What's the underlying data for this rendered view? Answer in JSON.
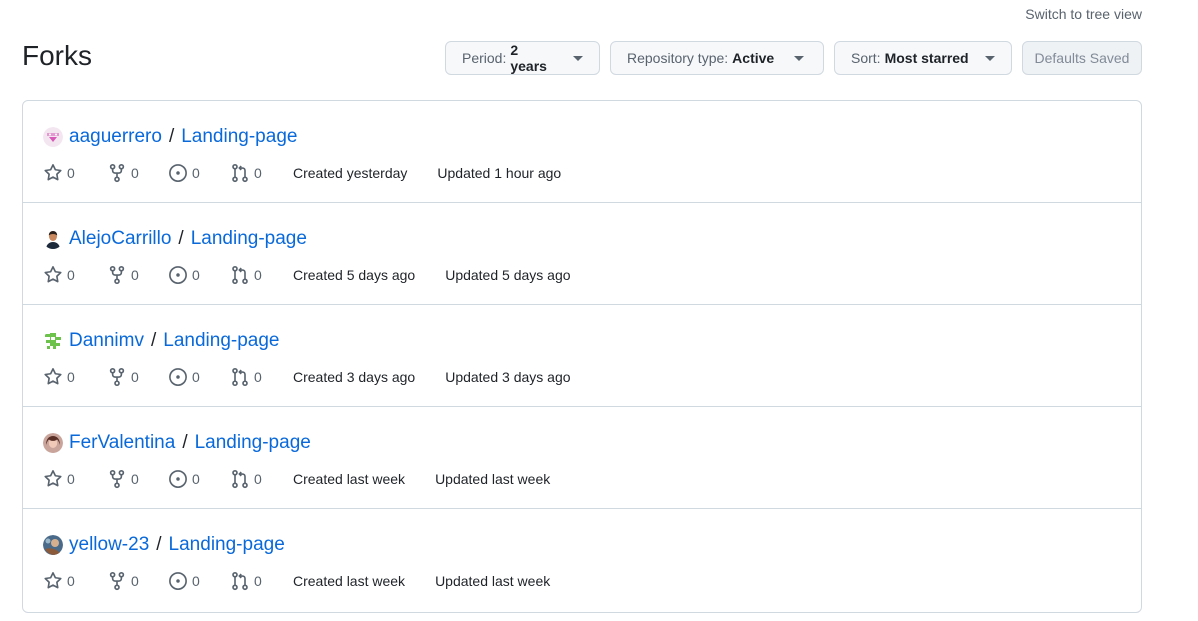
{
  "header": {
    "switch_link": "Switch to tree view",
    "title": "Forks"
  },
  "filters": {
    "period_label": "Period:",
    "period_value": "2 years",
    "repotype_label": "Repository type:",
    "repotype_value": "Active",
    "sort_label": "Sort:",
    "sort_value": "Most starred",
    "defaults_saved": "Defaults Saved"
  },
  "icons": {
    "star": "star-icon",
    "fork": "repo-forked-icon",
    "issue": "issue-opened-icon",
    "pr": "git-pull-request-icon",
    "caret": "triangle-down-icon"
  },
  "forks": [
    {
      "owner": "aaguerrero",
      "sep": "/",
      "repo": "Landing-page",
      "stars": "0",
      "forks": "0",
      "issues": "0",
      "prs": "0",
      "created": "Created yesterday",
      "updated": "Updated 1 hour ago"
    },
    {
      "owner": "AlejoCarrillo",
      "sep": "/",
      "repo": "Landing-page",
      "stars": "0",
      "forks": "0",
      "issues": "0",
      "prs": "0",
      "created": "Created 5 days ago",
      "updated": "Updated 5 days ago"
    },
    {
      "owner": "Dannimv",
      "sep": "/",
      "repo": "Landing-page",
      "stars": "0",
      "forks": "0",
      "issues": "0",
      "prs": "0",
      "created": "Created 3 days ago",
      "updated": "Updated 3 days ago"
    },
    {
      "owner": "FerValentina",
      "sep": "/",
      "repo": "Landing-page",
      "stars": "0",
      "forks": "0",
      "issues": "0",
      "prs": "0",
      "created": "Created last week",
      "updated": "Updated last week"
    },
    {
      "owner": "yellow-23",
      "sep": "/",
      "repo": "Landing-page",
      "stars": "0",
      "forks": "0",
      "issues": "0",
      "prs": "0",
      "created": "Created last week",
      "updated": "Updated last week"
    }
  ]
}
